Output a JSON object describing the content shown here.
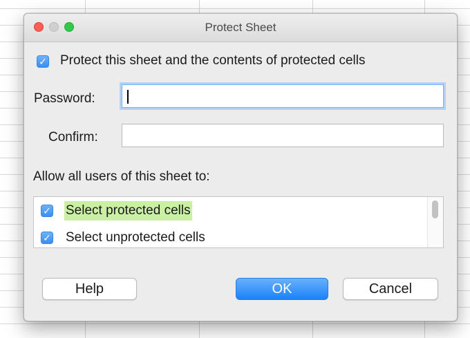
{
  "dialog": {
    "title": "Protect Sheet",
    "protect_checkbox": {
      "checked": true,
      "label": "Protect this sheet and the contents of protected cells"
    },
    "password": {
      "label": "Password:",
      "value": ""
    },
    "confirm": {
      "label": "Confirm:",
      "value": ""
    },
    "permissions_heading": "Allow all users of this sheet to:",
    "permissions": [
      {
        "label": "Select protected cells",
        "checked": true,
        "selected": true
      },
      {
        "label": "Select unprotected cells",
        "checked": true,
        "selected": false
      }
    ],
    "buttons": {
      "help": "Help",
      "ok": "OK",
      "cancel": "Cancel"
    }
  },
  "icons": {
    "checkmark": "checkmark-icon"
  },
  "colors": {
    "accent": "#3a8ef0",
    "selection_highlight": "#c9f0a3",
    "close": "#fd5f57",
    "maximize": "#34c749"
  }
}
